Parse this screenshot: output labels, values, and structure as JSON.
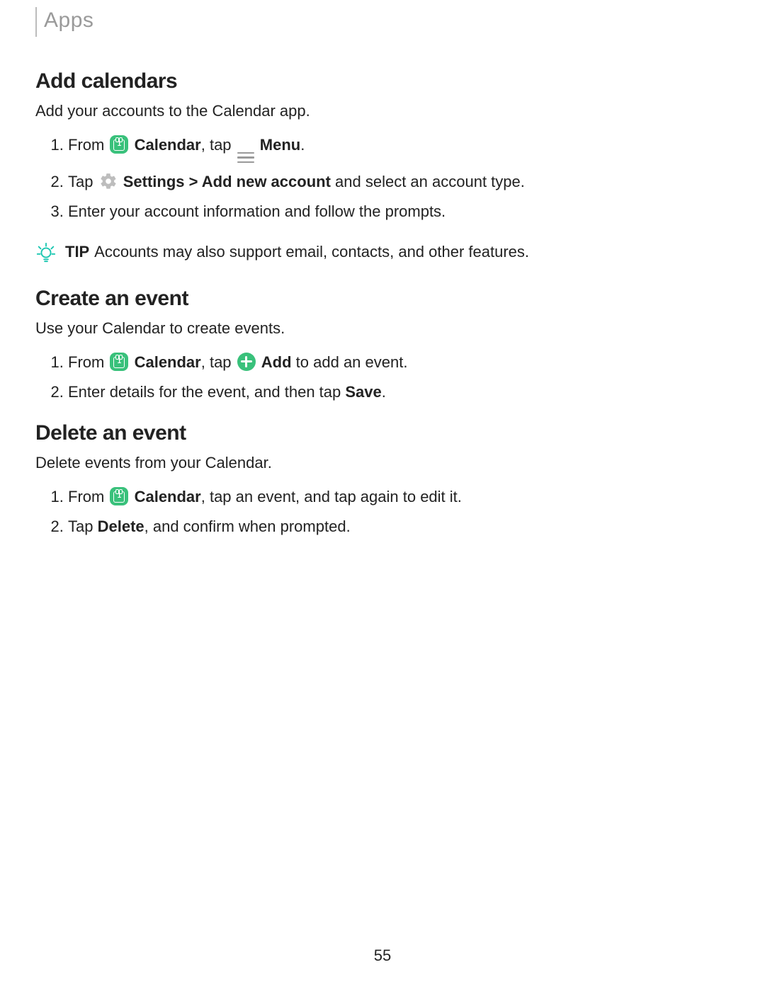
{
  "header": {
    "label": "Apps"
  },
  "pageNumber": "55",
  "section_add": {
    "title": "Add calendars",
    "desc": "Add your accounts to the Calendar app.",
    "steps": {
      "s1_pre": "From ",
      "s1_cal": "Calendar",
      "s1_mid": ", tap ",
      "s1_menu": "Menu",
      "s1_post": ".",
      "s2_pre": "Tap ",
      "s2_settings": "Settings",
      "s2_chev": " > ",
      "s2_addnew": "Add new account",
      "s2_post": " and select an account type.",
      "s3": "Enter your account information and follow the prompts."
    },
    "tip": {
      "label": "TIP",
      "text": "Accounts may also support email, contacts, and other features."
    }
  },
  "section_create": {
    "title": "Create an event",
    "desc": "Use your Calendar to create events.",
    "steps": {
      "s1_pre": "From ",
      "s1_cal": "Calendar",
      "s1_mid": ", tap ",
      "s1_add": "Add",
      "s1_post": " to add an event.",
      "s2_pre": "Enter details for the event, and then tap ",
      "s2_save": "Save",
      "s2_post": "."
    }
  },
  "section_delete": {
    "title": "Delete an event",
    "desc": "Delete events from your Calendar.",
    "steps": {
      "s1_pre": "From ",
      "s1_cal": "Calendar",
      "s1_post": ", tap an event, and tap again to edit it.",
      "s2_pre": "Tap ",
      "s2_delete": "Delete",
      "s2_post": ", and confirm when prompted."
    }
  }
}
